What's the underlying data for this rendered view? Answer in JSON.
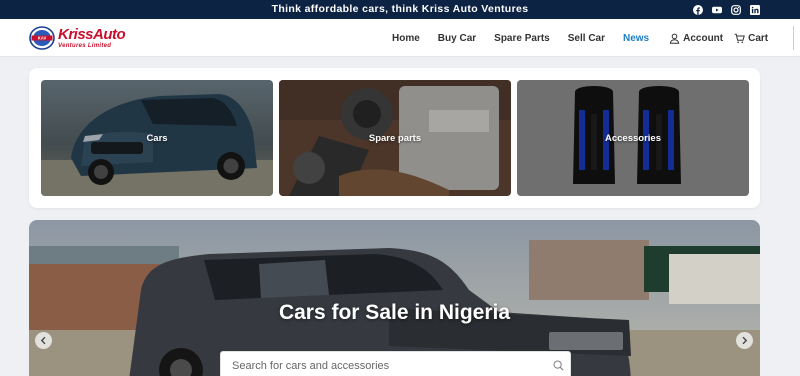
{
  "topbar": {
    "tagline": "Think affordable cars, think Kriss Auto Ventures",
    "social": [
      "facebook-icon",
      "youtube-icon",
      "instagram-icon",
      "linkedin-icon"
    ]
  },
  "logo": {
    "brand": "KrissAuto",
    "subtitle": "Ventures Limited",
    "badge": "KAV"
  },
  "nav": {
    "home": "Home",
    "buy_car": "Buy Car",
    "spare_parts": "Spare Parts",
    "sell_car": "Sell Car",
    "news": "News",
    "account": "Account",
    "cart": "Cart"
  },
  "categories": [
    {
      "label": "Cars"
    },
    {
      "label": "Spare parts"
    },
    {
      "label": "Accessories"
    }
  ],
  "hero": {
    "title": "Cars for Sale in Nigeria"
  },
  "search": {
    "placeholder": "Search for cars and accessories",
    "value": ""
  },
  "colors": {
    "topbar": "#0d2344",
    "brand_red": "#c8102e",
    "nav_active": "#1d7fc4",
    "page_bg": "#eef0f3"
  }
}
